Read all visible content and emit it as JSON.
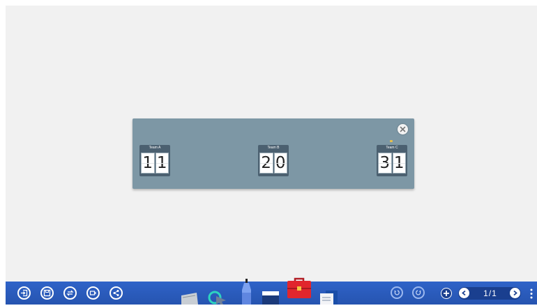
{
  "scoreboard": {
    "teams": [
      {
        "name": "Team A",
        "digits": [
          "1",
          "1"
        ]
      },
      {
        "name": "Team B",
        "digits": [
          "2",
          "0"
        ]
      },
      {
        "name": "Team C",
        "digits": [
          "3",
          "1"
        ]
      }
    ]
  },
  "toolbar": {
    "page_indicator": "1/1",
    "left_buttons": [
      "exit-icon",
      "save-icon",
      "switch-icon",
      "record-icon",
      "share-icon"
    ],
    "center_tools": [
      "ruler-icon",
      "select-icon",
      "pen-icon",
      "eraser-icon",
      "toolbox-icon",
      "documents-icon"
    ],
    "right_buttons": [
      "undo-icon",
      "redo-icon",
      "add-page-icon",
      "prev-page-icon",
      "next-page-icon",
      "more-icon"
    ]
  },
  "colors": {
    "panel": "#7d97a5",
    "team_box": "#4b6070",
    "toolbar": "#2f63c8",
    "board": "#f1f1f1"
  }
}
